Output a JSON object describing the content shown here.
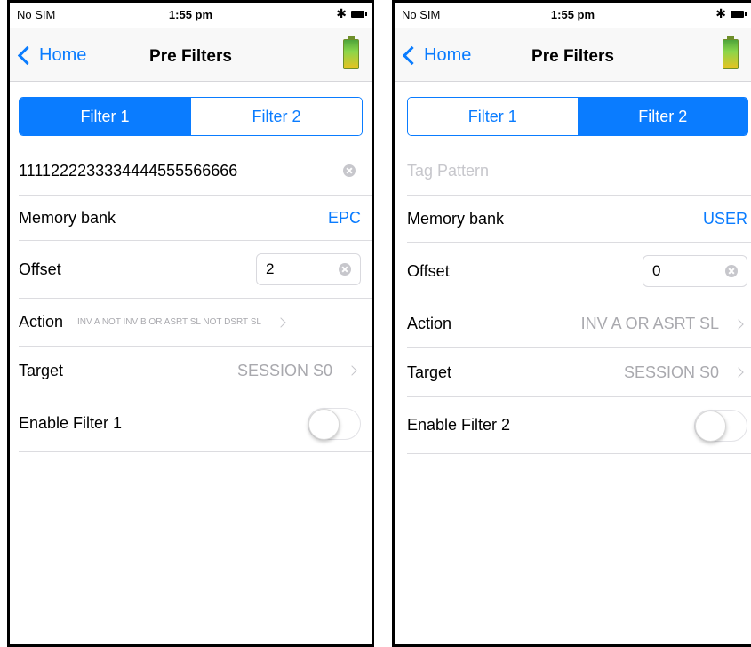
{
  "status": {
    "carrier": "No SIM",
    "time": "1:55 pm"
  },
  "nav": {
    "back_label": "Home",
    "title": "Pre Filters",
    "battery_icon": "battery-icon"
  },
  "tabs": [
    "Filter 1",
    "Filter 2"
  ],
  "labels": {
    "memory_bank": "Memory bank",
    "offset": "Offset",
    "action": "Action",
    "target": "Target"
  },
  "screens": [
    {
      "active_tab": 0,
      "tag_pattern_value": "1111222233334444555566666",
      "tag_pattern_placeholder": "",
      "memory_bank": "EPC",
      "offset": "2",
      "action": "INV A NOT INV B OR ASRT SL NOT DSRT SL",
      "target": "SESSION S0",
      "enable_label": "Enable Filter 1",
      "enabled": false
    },
    {
      "active_tab": 1,
      "tag_pattern_value": "",
      "tag_pattern_placeholder": "Tag Pattern",
      "memory_bank": "USER",
      "offset": "0",
      "action": "INV A OR ASRT SL",
      "target": "SESSION S0",
      "enable_label": "Enable Filter 2",
      "enabled": false
    }
  ],
  "colors": {
    "accent": "#0a7cff",
    "secondary_text": "#a9a9ae",
    "separator": "#dcdce0"
  }
}
